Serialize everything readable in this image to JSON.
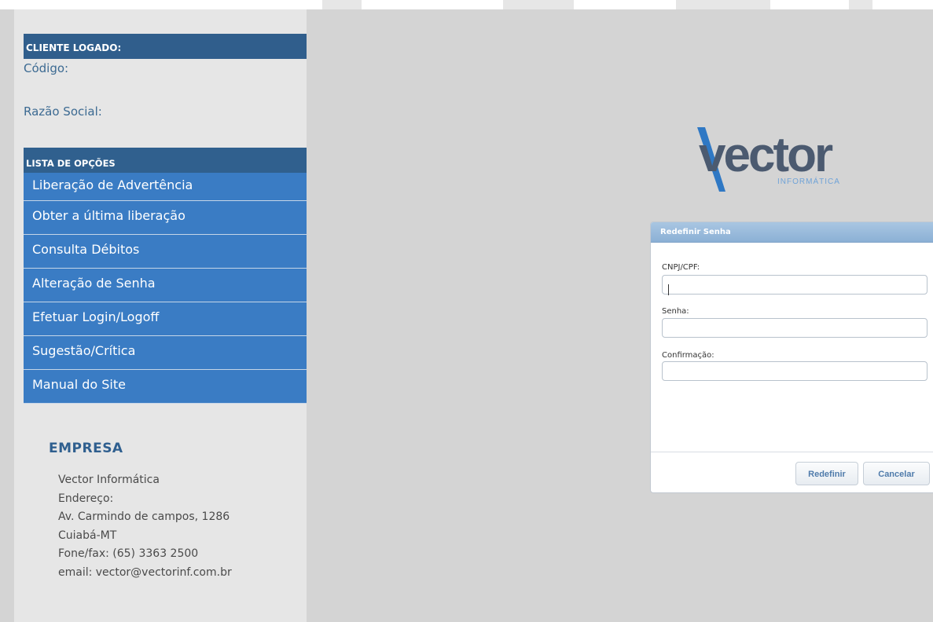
{
  "sidebar": {
    "client_header": "CLIENTE LOGADO:",
    "codigo_label": "Código:",
    "razao_label": "Razão Social:",
    "options_header": "LISTA DE OPÇÕES",
    "menu": [
      "Liberação de Advertência",
      "Obter a última liberação",
      "Consulta Débitos",
      "Alteração de Senha",
      "Efetuar Login/Logoff",
      "Sugestão/Crítica",
      "Manual do Site"
    ],
    "empresa": {
      "title": "EMPRESA",
      "lines": [
        "Vector Informática",
        "Endereço:",
        "Av. Carmindo de campos, 1286",
        "Cuiabá-MT",
        "Fone/fax: (65) 3363 2500",
        "email: vector@vectorinf.com.br"
      ]
    }
  },
  "logo": {
    "main": "vector",
    "sub": "INFORMÁTICA",
    "main_color": "#4b5a70",
    "accent_color": "#2f78c4"
  },
  "dialog": {
    "title": "Redefinir Senha",
    "fields": [
      {
        "label": "CNPJ/CPF:",
        "value": ""
      },
      {
        "label": "Senha:",
        "value": ""
      },
      {
        "label": "Confirmação:",
        "value": ""
      }
    ],
    "buttons": {
      "submit": "Redefinir",
      "cancel": "Cancelar"
    }
  },
  "colors": {
    "menu_bg": "#3a7cc4",
    "header_bg": "#2f5f8f",
    "page_bg": "#d4d4d4"
  }
}
